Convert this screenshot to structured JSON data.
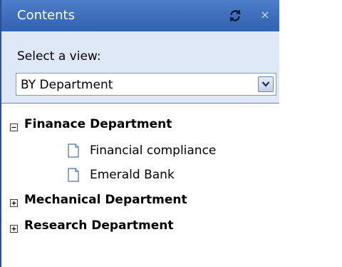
{
  "panel": {
    "title": "Contents",
    "refresh_icon": "refresh-icon",
    "close_label": "×",
    "accent_color": "#3d6dbb"
  },
  "view": {
    "label": "Select a view:",
    "selected": "BY Department"
  },
  "tree": {
    "departments": [
      {
        "label": "Finanace Department",
        "expanded": true,
        "items": [
          {
            "label": "Financial compliance",
            "icon": "document-icon"
          },
          {
            "label": "Emerald Bank",
            "icon": "document-icon"
          }
        ]
      },
      {
        "label": "Mechanical Department",
        "expanded": false,
        "items": []
      },
      {
        "label": "Research Department",
        "expanded": false,
        "items": []
      }
    ]
  }
}
